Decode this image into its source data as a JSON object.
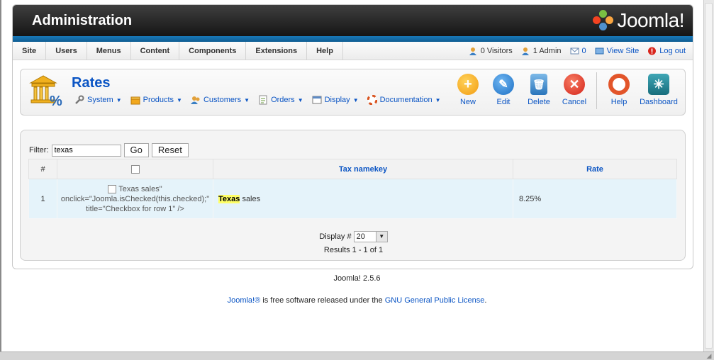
{
  "header": {
    "title": "Administration",
    "logo_text": "Joomla!"
  },
  "menu": {
    "items": [
      {
        "label": "Site"
      },
      {
        "label": "Users"
      },
      {
        "label": "Menus"
      },
      {
        "label": "Content"
      },
      {
        "label": "Components"
      },
      {
        "label": "Extensions"
      },
      {
        "label": "Help"
      }
    ],
    "visitors": "0 Visitors",
    "admins": "1 Admin",
    "messages": "0",
    "view_site": "View Site",
    "logout": "Log out"
  },
  "toolbar": {
    "page_title": "Rates",
    "submenu": [
      {
        "label": "System"
      },
      {
        "label": "Products"
      },
      {
        "label": "Customers"
      },
      {
        "label": "Orders"
      },
      {
        "label": "Display"
      },
      {
        "label": "Documentation"
      }
    ],
    "buttons": {
      "new": "New",
      "edit": "Edit",
      "delete": "Delete",
      "cancel": "Cancel",
      "help": "Help",
      "dashboard": "Dashboard"
    }
  },
  "filter": {
    "label": "Filter:",
    "value": "texas",
    "go_label": "Go",
    "reset_label": "Reset"
  },
  "table": {
    "headers": {
      "num": "#",
      "namekey": "Tax namekey",
      "rate": "Rate"
    },
    "rows": [
      {
        "num": "1",
        "checkbox_text": [
          "Texas sales\"",
          "onclick=\"Joomla.isChecked(this.checked);\"",
          "title=\"Checkbox for row 1\" />"
        ],
        "namekey_highlight": "Texas",
        "namekey_rest": "sales",
        "rate": "8.25%"
      }
    ]
  },
  "pager": {
    "display_label": "Display #",
    "display_value": "20",
    "results": "Results 1 - 1 of 1"
  },
  "footer": {
    "version": "Joomla! 2.5.6",
    "license_link1": "Joomla!®",
    "license_mid": " is free software released under the ",
    "license_link2": "GNU General Public License",
    "license_end": "."
  }
}
